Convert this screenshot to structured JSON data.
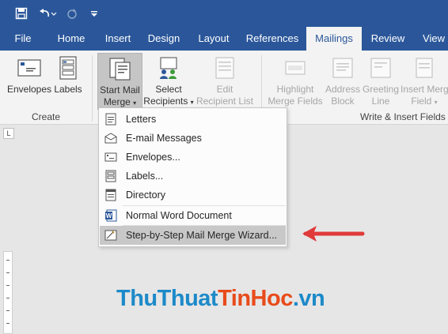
{
  "qat": {
    "icons": [
      "save-icon",
      "undo-icon",
      "redo-icon",
      "customize-icon"
    ]
  },
  "tabs": [
    {
      "label": "File"
    },
    {
      "label": "Home"
    },
    {
      "label": "Insert"
    },
    {
      "label": "Design"
    },
    {
      "label": "Layout"
    },
    {
      "label": "References"
    },
    {
      "label": "Mailings",
      "active": true
    },
    {
      "label": "Review"
    },
    {
      "label": "View"
    }
  ],
  "ribbon": {
    "envelopes": "Envelopes",
    "labels": "Labels",
    "start_mail_merge_1": "Start Mail",
    "start_mail_merge_2": "Merge",
    "select_recipients_1": "Select",
    "select_recipients_2": "Recipients",
    "edit_recipient_list_1": "Edit",
    "edit_recipient_list_2": "Recipient List",
    "highlight_merge_fields_1": "Highlight",
    "highlight_merge_fields_2": "Merge Fields",
    "address_block_1": "Address",
    "address_block_2": "Block",
    "greeting_line_1": "Greeting",
    "greeting_line_2": "Line",
    "insert_merge_field_1": "Insert Merg",
    "insert_merge_field_2": "Field",
    "group_create": "Create",
    "group_write_insert": "Write & Insert Fields"
  },
  "ruler": {
    "corner_label": "L"
  },
  "menu": {
    "items": [
      {
        "label": "Letters",
        "icon": "letter-icon"
      },
      {
        "label": "E-mail Messages",
        "icon": "email-icon"
      },
      {
        "label": "Envelopes...",
        "icon": "envelope-icon"
      },
      {
        "label": "Labels...",
        "icon": "labels-icon"
      },
      {
        "label": "Directory",
        "icon": "directory-icon"
      },
      {
        "label": "Normal Word Document",
        "icon": "word-icon"
      },
      {
        "label": "Step-by-Step Mail Merge Wizard...",
        "icon": "wizard-icon",
        "highlighted": true
      }
    ]
  },
  "watermark": {
    "part1": "ThuThuat",
    "part2": "TinHoc",
    "part3": ".vn"
  },
  "colors": {
    "accent": "#2b579a",
    "arrow": "#e03a3a",
    "ribbon_bg": "#f3f3f3"
  }
}
